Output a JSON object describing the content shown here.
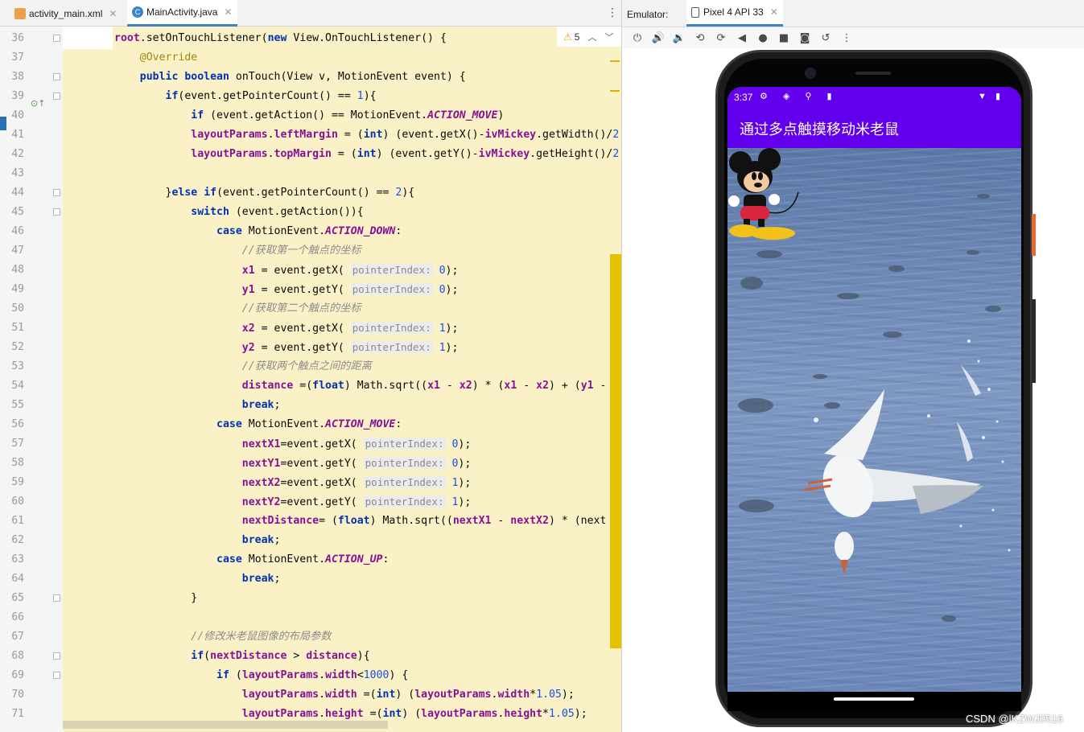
{
  "editor": {
    "tabs": [
      {
        "label": "activity_main.xml",
        "active": false,
        "icon": "xml-file-icon"
      },
      {
        "label": "MainActivity.java",
        "active": true,
        "icon": "java-class-icon"
      }
    ],
    "warnings_count": "5",
    "line_numbers": [
      "36",
      "37",
      "38",
      "39",
      "40",
      "41",
      "42",
      "43",
      "44",
      "45",
      "46",
      "47",
      "48",
      "49",
      "50",
      "51",
      "52",
      "53",
      "54",
      "55",
      "56",
      "57",
      "58",
      "59",
      "60",
      "61",
      "62",
      "63",
      "64",
      "65",
      "66",
      "67",
      "68",
      "69",
      "70",
      "71"
    ],
    "code_lines": [
      "root.setOnTouchListener(new View.OnTouchListener() {",
      "    @Override",
      "    public boolean onTouch(View v, MotionEvent event) {",
      "        if(event.getPointerCount() == 1){",
      "            if (event.getAction() == MotionEvent.ACTION_MOVE)",
      "            layoutParams.leftMargin = (int) (event.getX()-ivMickey.getWidth()/2",
      "            layoutParams.topMargin = (int) (event.getY()-ivMickey.getHeight()/2",
      "",
      "        }else if(event.getPointerCount() == 2){",
      "            switch (event.getAction()){",
      "                case MotionEvent.ACTION_DOWN:",
      "                    //获取第一个触点的坐标",
      "                    x1 = event.getX( pointerIndex: 0);",
      "                    y1 = event.getY( pointerIndex: 0);",
      "                    //获取第二个触点的坐标",
      "                    x2 = event.getX( pointerIndex: 1);",
      "                    y2 = event.getY( pointerIndex: 1);",
      "                    //获取两个触点之间的距离",
      "                    distance =(float) Math.sqrt((x1 - x2) * (x1 - x2) + (y1 -",
      "                    break;",
      "                case MotionEvent.ACTION_MOVE:",
      "                    nextX1=event.getX( pointerIndex: 0);",
      "                    nextY1=event.getY( pointerIndex: 0);",
      "                    nextX2=event.getX( pointerIndex: 1);",
      "                    nextY2=event.getY( pointerIndex: 1);",
      "                    nextDistance= (float) Math.sqrt((nextX1 - nextX2) * (next",
      "                    break;",
      "                case MotionEvent.ACTION_UP:",
      "                    break;",
      "            }",
      "",
      "            //修改米老鼠图像的布局参数",
      "            if(nextDistance > distance){",
      "                if (layoutParams.width<1000) {",
      "                    layoutParams.width =(int) (layoutParams.width*1.05);",
      "                    layoutParams.height =(int) (layoutParams.height*1.05);"
    ]
  },
  "emulator": {
    "label": "Emulator:",
    "device_tab": "Pixel 4 API 33",
    "toolbar_icons": [
      "power-icon",
      "volume-up-icon",
      "volume-down-icon",
      "rotate-left-icon",
      "rotate-right-icon",
      "back-icon",
      "home-icon",
      "overview-icon",
      "screenshot-icon",
      "snapshot-icon",
      "more-icon"
    ],
    "phone": {
      "status_time": "3:37",
      "app_title": "通过多点触摸移动米老鼠"
    }
  },
  "watermark": "CSDN @lKZWJ0516",
  "colors": {
    "app_bar": "#6200ee",
    "code_background": "#fbf1c6",
    "keyword": "#0033b3",
    "field": "#871094",
    "number": "#1750eb",
    "annotation": "#9e880d",
    "comment": "#8c8c8c"
  }
}
